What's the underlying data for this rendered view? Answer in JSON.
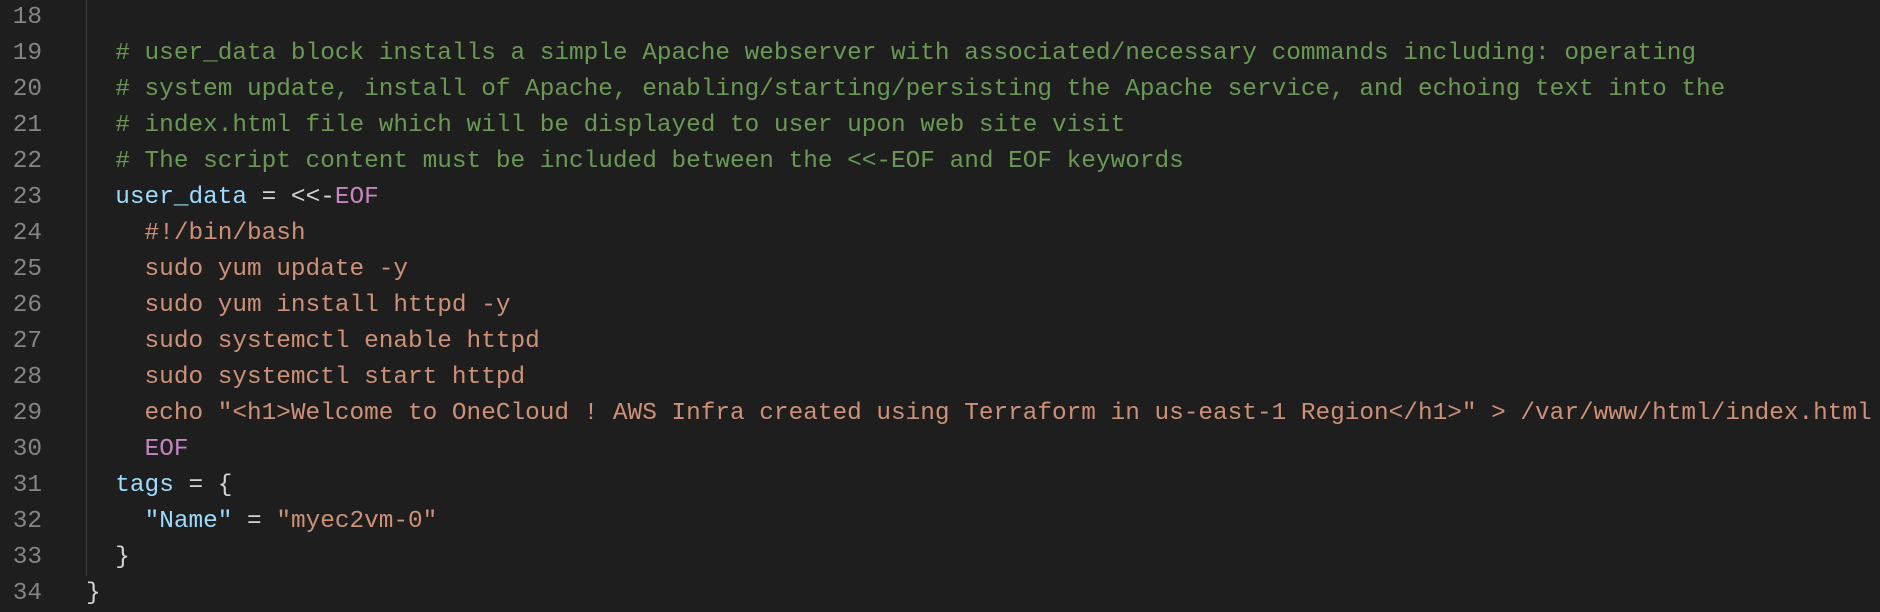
{
  "colors": {
    "background": "#1e1e1e",
    "comment": "#6a9955",
    "variable": "#9cdcfe",
    "string": "#ce9178",
    "keyword": "#c586c0",
    "text": "#d4d4d4",
    "line_number": "#858585"
  },
  "lines": [
    {
      "number": "18",
      "tokens": []
    },
    {
      "number": "19",
      "tokens": [
        [
          "comment",
          "  # user_data block installs a simple Apache webserver with associated/necessary commands including: operating"
        ]
      ]
    },
    {
      "number": "20",
      "tokens": [
        [
          "comment",
          "  # system update, install of Apache, enabling/starting/persisting the Apache service, and echoing text into the"
        ]
      ]
    },
    {
      "number": "21",
      "tokens": [
        [
          "comment",
          "  # index.html file which will be displayed to user upon web site visit"
        ]
      ]
    },
    {
      "number": "22",
      "tokens": [
        [
          "comment",
          "  # The script content must be included between the <<-EOF and EOF keywords"
        ]
      ]
    },
    {
      "number": "23",
      "tokens": [
        [
          "op",
          "  "
        ],
        [
          "var",
          "user_data"
        ],
        [
          "op",
          " = <<-"
        ],
        [
          "kw",
          "EOF"
        ]
      ]
    },
    {
      "number": "24",
      "tokens": [
        [
          "str",
          "    #!/bin/bash"
        ]
      ]
    },
    {
      "number": "25",
      "tokens": [
        [
          "str",
          "    sudo yum update -y"
        ]
      ]
    },
    {
      "number": "26",
      "tokens": [
        [
          "str",
          "    sudo yum install httpd -y"
        ]
      ]
    },
    {
      "number": "27",
      "tokens": [
        [
          "str",
          "    sudo systemctl enable httpd"
        ]
      ]
    },
    {
      "number": "28",
      "tokens": [
        [
          "str",
          "    sudo systemctl start httpd"
        ]
      ]
    },
    {
      "number": "29",
      "tokens": [
        [
          "str",
          "    echo \"<h1>Welcome to OneCloud ! AWS Infra created using Terraform in us-east-1 Region</h1>\" > /var/www/html/index.html"
        ]
      ]
    },
    {
      "number": "30",
      "tokens": [
        [
          "op",
          "    "
        ],
        [
          "kw",
          "EOF"
        ]
      ]
    },
    {
      "number": "31",
      "tokens": [
        [
          "op",
          "  "
        ],
        [
          "var",
          "tags"
        ],
        [
          "op",
          " = {"
        ]
      ]
    },
    {
      "number": "32",
      "tokens": [
        [
          "op",
          "    "
        ],
        [
          "var",
          "\"Name\""
        ],
        [
          "op",
          " = "
        ],
        [
          "str",
          "\"myec2vm-0\""
        ]
      ]
    },
    {
      "number": "33",
      "tokens": [
        [
          "op",
          "  }"
        ]
      ]
    },
    {
      "number": "34",
      "tokens": [
        [
          "op",
          "}"
        ]
      ]
    }
  ]
}
